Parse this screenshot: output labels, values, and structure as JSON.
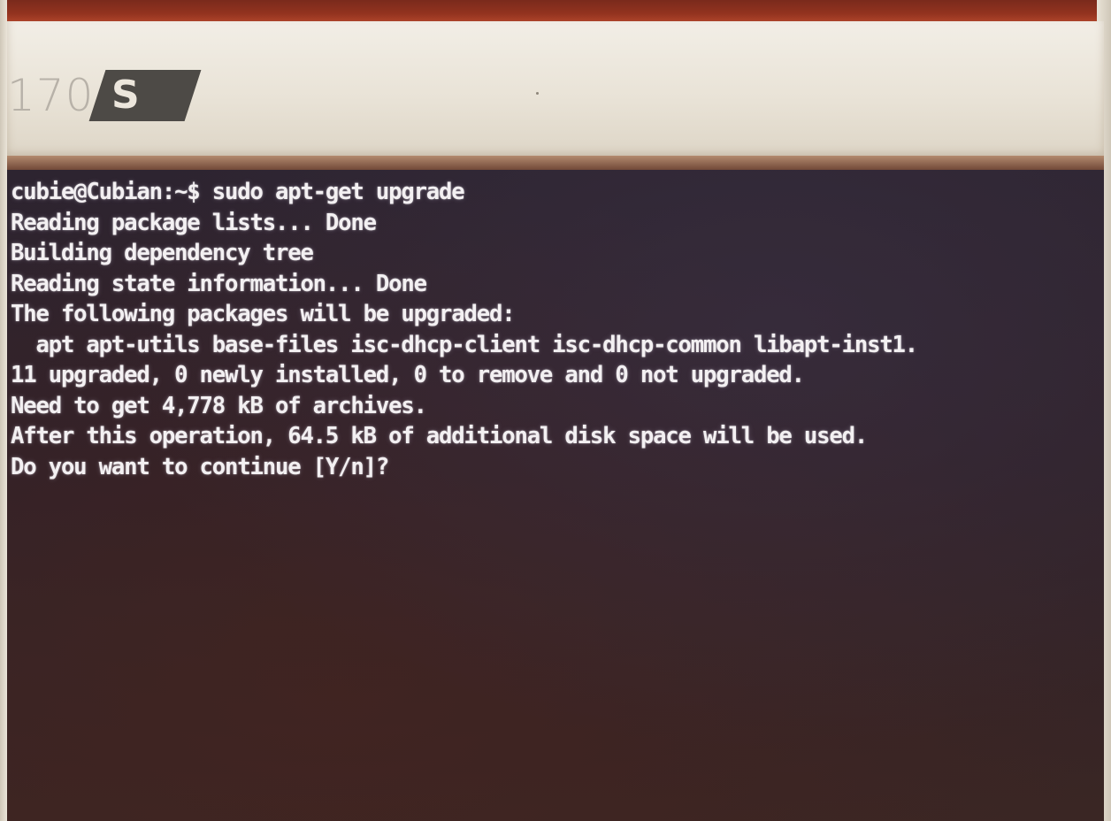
{
  "monitor": {
    "model_number": "170",
    "model_suffix": "S"
  },
  "terminal": {
    "lines": [
      "cubie@Cubian:~$ sudo apt-get upgrade",
      "Reading package lists... Done",
      "Building dependency tree",
      "Reading state information... Done",
      "The following packages will be upgraded:",
      "  apt apt-utils base-files isc-dhcp-client isc-dhcp-common libapt-inst1.",
      "11 upgraded, 0 newly installed, 0 to remove and 0 not upgraded.",
      "Need to get 4,778 kB of archives.",
      "After this operation, 64.5 kB of additional disk space will be used.",
      "Do you want to continue [Y/n]?"
    ]
  }
}
